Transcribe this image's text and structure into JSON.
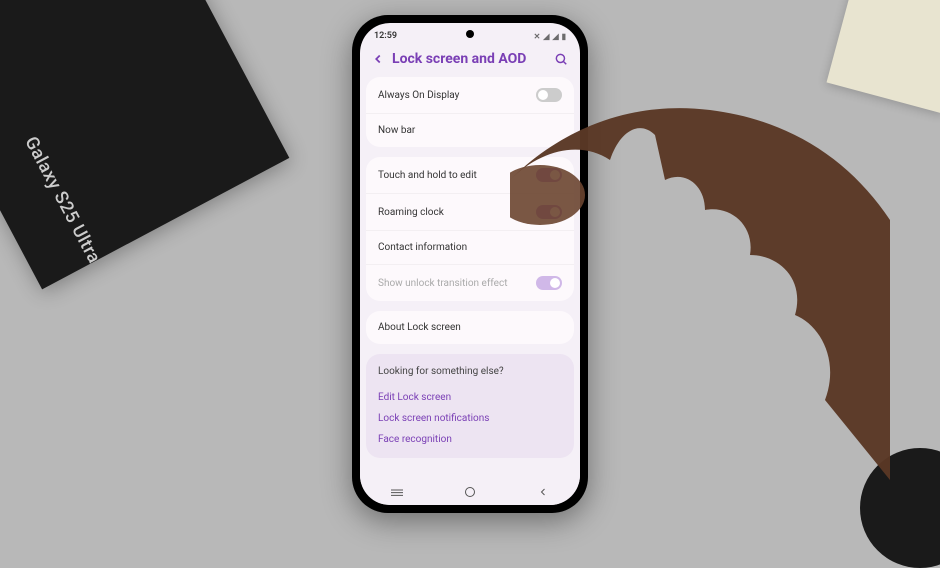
{
  "box_label": "Galaxy S25 Ultra",
  "status": {
    "time": "12:59"
  },
  "header": {
    "title": "Lock screen and AOD"
  },
  "section1": {
    "always_on_display": "Always On Display",
    "now_bar": "Now bar"
  },
  "section2": {
    "touch_hold": "Touch and hold to edit",
    "roaming": "Roaming clock",
    "contact": "Contact information",
    "unlock_effect": "Show unlock transition effect"
  },
  "section3": {
    "about": "About Lock screen"
  },
  "footer": {
    "heading": "Looking for something else?",
    "edit_lock": "Edit Lock screen",
    "notifications": "Lock screen notifications",
    "face": "Face recognition"
  }
}
